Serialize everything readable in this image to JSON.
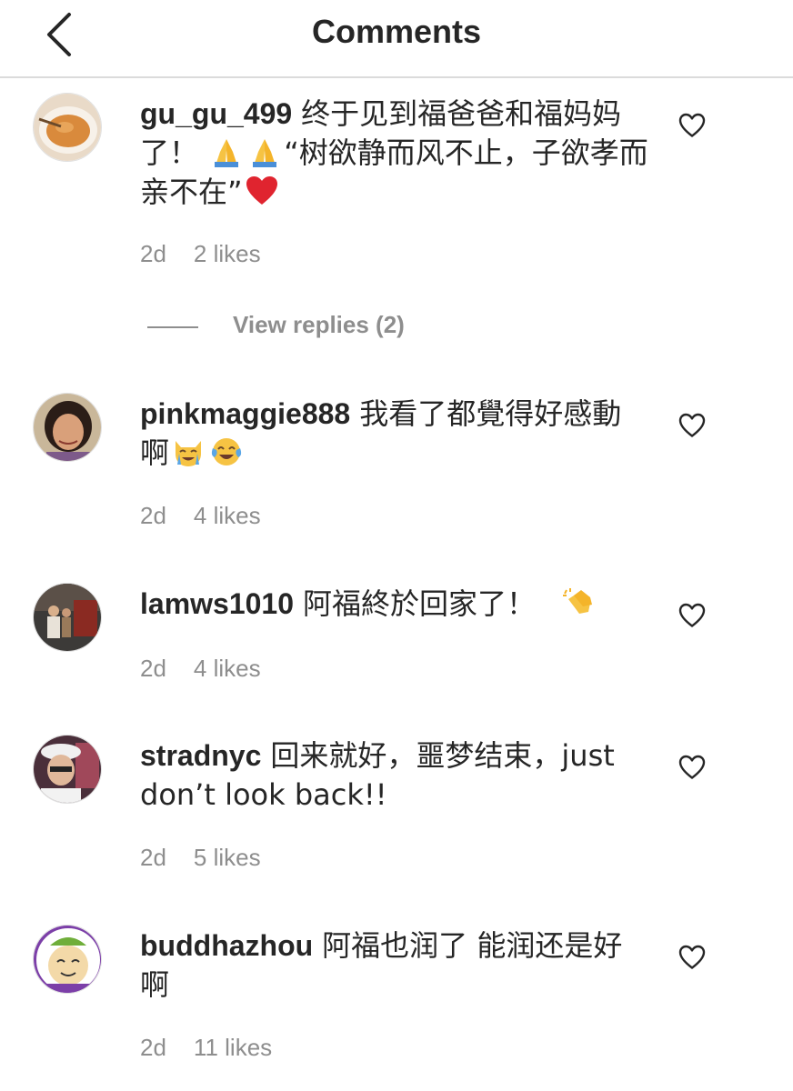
{
  "header": {
    "title": "Comments",
    "back_icon": "chevron-left-icon"
  },
  "comments": [
    {
      "username": "gu_gu_499",
      "segments": [
        "终于见到福爸爸和福妈妈了！",
        "“树欲静而风不止，子欲孝而亲不在”"
      ],
      "emojis": [
        "folded-hands",
        "folded-hands",
        "red-heart"
      ],
      "time": "2d",
      "likes": "2 likes",
      "view_replies": "View replies (2)"
    },
    {
      "username": "pinkmaggie888",
      "segments": [
        "我看了都覺得好感動啊"
      ],
      "emojis": [
        "crying-cat",
        "tears-of-joy"
      ],
      "time": "2d",
      "likes": "4 likes"
    },
    {
      "username": "lamws1010",
      "segments": [
        "阿福終於回家了！"
      ],
      "emojis": [
        "clapping-hands"
      ],
      "time": "2d",
      "likes": "4 likes"
    },
    {
      "username": "stradnyc",
      "segments": [
        "回来就好，噩梦结束，just don’t look back!!"
      ],
      "time": "2d",
      "likes": "5 likes"
    },
    {
      "username": "buddhazhou",
      "segments": [
        "阿福也润了 能润还是好啊"
      ],
      "time": "2d",
      "likes": "11 likes"
    }
  ],
  "icons": {
    "like": "heart-outline-icon",
    "back": "chevron-left-icon"
  },
  "colors": {
    "text": "#262626",
    "secondary": "#8e8e8e",
    "divider": "#dbdbdb"
  }
}
